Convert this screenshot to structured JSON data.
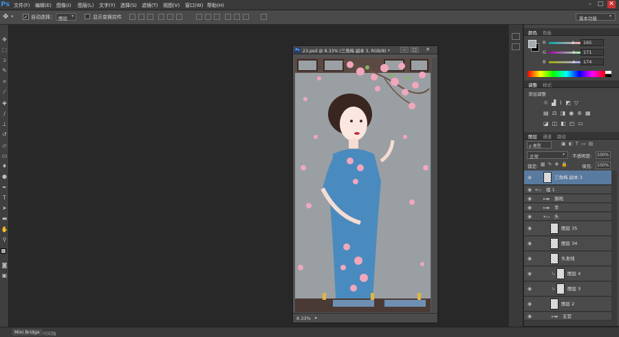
{
  "app": {
    "logo": "Ps",
    "accent": "#3a8fd9"
  },
  "menu": [
    "文件(F)",
    "编辑(E)",
    "图像(I)",
    "图层(L)",
    "文字(Y)",
    "选择(S)",
    "滤镜(T)",
    "视图(V)",
    "窗口(W)",
    "帮助(H)"
  ],
  "window_controls": [
    "–",
    "□",
    "✕"
  ],
  "options": {
    "auto_select_label": "自动选择：",
    "auto_select_value": "图层",
    "show_transform_label": "显示变换控件",
    "workspace": "基本功能"
  },
  "document": {
    "title": "23.psd @ 8.33% (三角梅  副本 3, RGB/8) *",
    "zoom": "8.33%"
  },
  "color_panel": {
    "tabs": [
      "颜色",
      "色板"
    ],
    "channels": [
      {
        "label": "R",
        "value": "165"
      },
      {
        "label": "G",
        "value": "171"
      },
      {
        "label": "B",
        "value": "174"
      }
    ],
    "foreground": "#a5abae"
  },
  "adjust_panel": {
    "tabs": [
      "调整",
      "样式"
    ],
    "title": "添加调整"
  },
  "layers_panel": {
    "tabs": [
      "图层",
      "通道",
      "路径"
    ],
    "filter": "ρ 类型",
    "blend_mode": "正常",
    "opacity_label": "不透明度:",
    "opacity_value": "100%",
    "lock_label": "锁定:",
    "fill_label": "填充:",
    "fill_value": "100%",
    "layers": [
      {
        "name": "三角梅  副本 3",
        "kind": "layer",
        "selected": true
      },
      {
        "name": "组 1",
        "kind": "group"
      },
      {
        "name": "旗袍",
        "kind": "group"
      },
      {
        "name": "手",
        "kind": "group"
      },
      {
        "name": "头",
        "kind": "group"
      },
      {
        "name": "图层 35",
        "kind": "layer"
      },
      {
        "name": "图层 34",
        "kind": "layer"
      },
      {
        "name": "头发线",
        "kind": "layer"
      },
      {
        "name": "图层 4",
        "kind": "layer"
      },
      {
        "name": "图层 3",
        "kind": "layer"
      },
      {
        "name": "图层 2",
        "kind": "layer"
      },
      {
        "name": "五官",
        "kind": "group"
      }
    ]
  },
  "bottom_tabs": [
    "Mini Bridge",
    "时间轴"
  ]
}
